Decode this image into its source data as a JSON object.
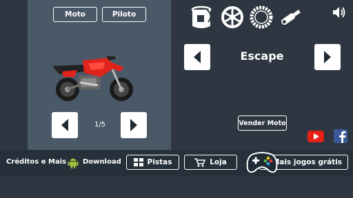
{
  "top_tabs": {
    "moto_label": "Moto",
    "piloto_label": "Piloto"
  },
  "bike_pager": {
    "page_indicator": "1/5"
  },
  "parts": {
    "current_part": "Escape",
    "icons": [
      "paint-bucket-icon",
      "wheel-spokes-icon",
      "tire-icon",
      "exhaust-icon"
    ]
  },
  "actions": {
    "sell_label": "Vender Moto"
  },
  "bottom_bar": {
    "credits_label": "Créditos e Mais",
    "download_label": "Download",
    "tracks_label": "Pistas",
    "shop_label": "Loja",
    "more_games_label": "Mais jogos grátis"
  },
  "colors": {
    "background": "#2e3741",
    "panel": "#4a5967",
    "bottom_bar": "#25303a",
    "bike_red": "#e0231c",
    "youtube_red": "#e62117",
    "facebook_blue": "#3b5998",
    "android_green": "#9fbf3b"
  }
}
